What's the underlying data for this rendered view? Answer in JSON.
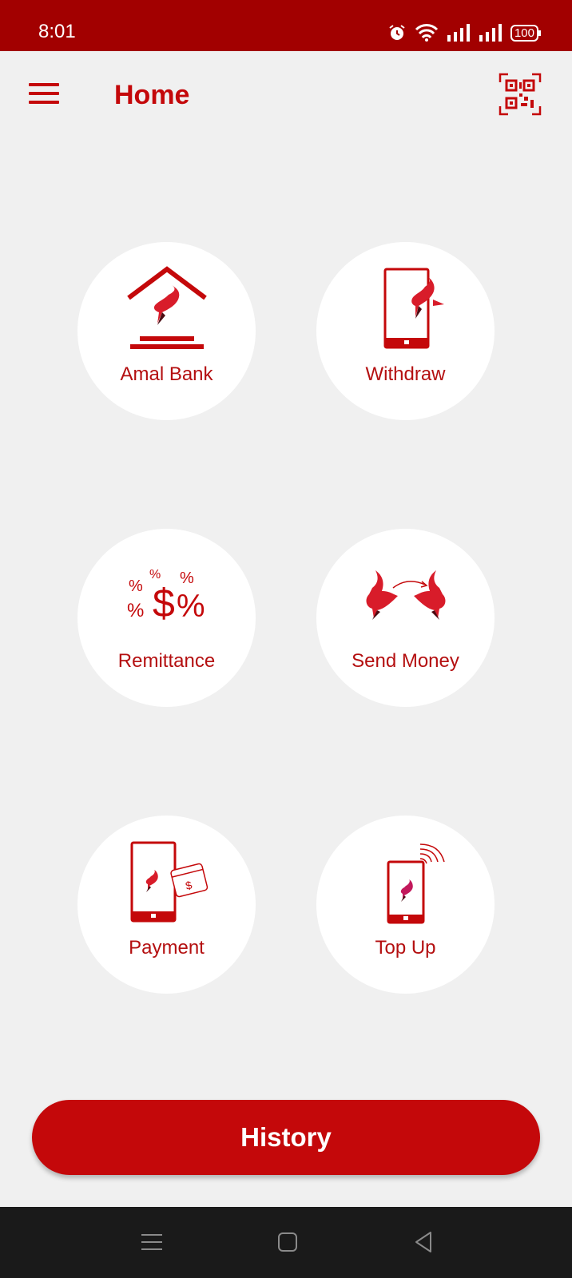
{
  "status_bar": {
    "time": "8:01",
    "battery": "100"
  },
  "app_bar": {
    "title": "Home"
  },
  "tiles": [
    {
      "label": "Amal Bank",
      "icon": "bank-house-icon"
    },
    {
      "label": "Withdraw",
      "icon": "phone-withdraw-icon"
    },
    {
      "label": "Remittance",
      "icon": "dollar-percent-icon"
    },
    {
      "label": "Send Money",
      "icon": "birds-transfer-icon"
    },
    {
      "label": "Payment",
      "icon": "phone-card-icon"
    },
    {
      "label": "Top Up",
      "icon": "phone-signal-icon"
    }
  ],
  "history": {
    "label": "History"
  },
  "colors": {
    "brand": "#c4080a",
    "status_bar": "#a20000",
    "background": "#f0f0f0"
  }
}
